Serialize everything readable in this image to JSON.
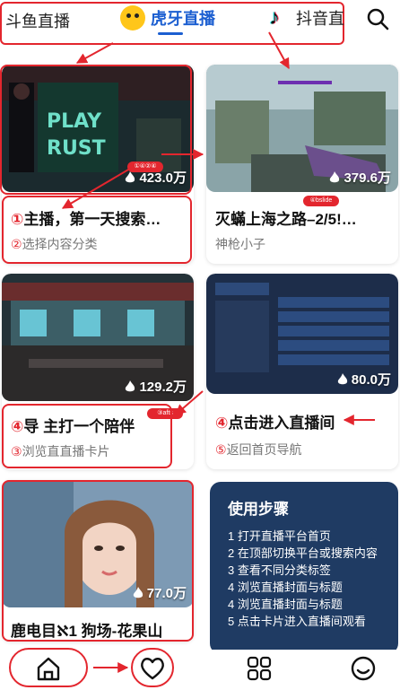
{
  "top_nav": {
    "tabs": [
      {
        "label": "斗鱼直播"
      },
      {
        "label": "虎牙直播",
        "active": true
      },
      {
        "label": "抖音直"
      }
    ],
    "search_icon": "search-icon"
  },
  "cards": [
    {
      "viewers": "423.0万",
      "title_num": "①",
      "title": "主播，第一天搜索…",
      "sub_num": "②",
      "sub": "选择内容分类",
      "badge": "①④②④"
    },
    {
      "viewers": "379.6万",
      "title": "灭蟎上海之路–2/5!…",
      "sub": "神枪小子",
      "badge": "④bslide"
    },
    {
      "viewers": "129.2万",
      "title_num": "④",
      "title": "导 主打一个陪伴",
      "sub_num": "③",
      "sub": "浏览直直播卡片",
      "badge": "③afts"
    },
    {
      "viewers": "80.0万",
      "title_num": "④",
      "title": "点击进入直播间",
      "sub_num": "⑤",
      "sub": "返回首页导航"
    },
    {
      "viewers": "77.0万",
      "title": "鹿电目ℵ1 狗场-花果山"
    }
  ],
  "instructions": {
    "heading": "使用步骤",
    "steps": [
      "1  打开直播平台首页",
      "2  在顶部切换平台或搜索内容",
      "3  查看不同分类标签",
      "4  浏览直播封面与标题",
      "4  浏览直播封面与标题",
      "5  点击卡片进入直播间观看"
    ]
  },
  "bottom_nav": {
    "items": [
      "home-icon",
      "heart-icon",
      "grid-icon",
      "smile-icon"
    ]
  },
  "colors": {
    "accent": "#1c5fd1",
    "annotation": "#e3262e",
    "panel": "#1f3b63"
  }
}
